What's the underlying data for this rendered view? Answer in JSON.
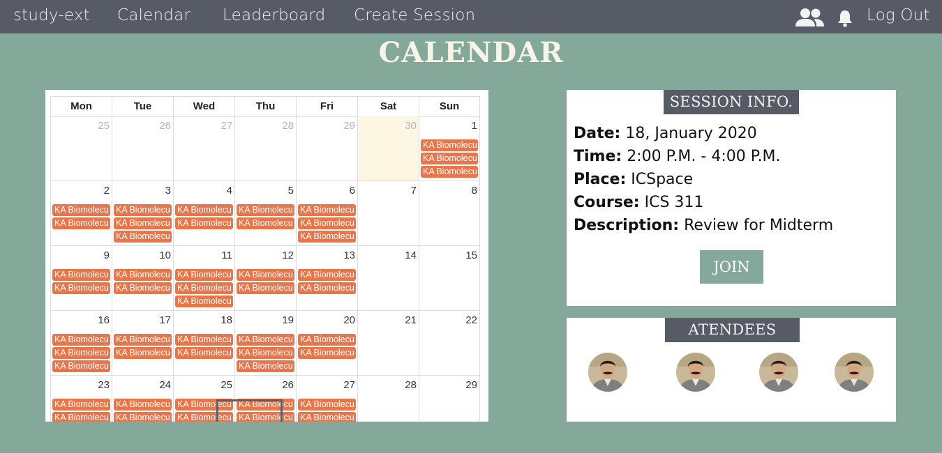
{
  "nav": {
    "brand": "study-ext",
    "calendar": "Calendar",
    "leaderboard": "Leaderboard",
    "create_session": "Create Session",
    "logout": "Log Out"
  },
  "page_title": "CALENDAR",
  "calendar": {
    "weekdays": [
      "Mon",
      "Tue",
      "Wed",
      "Thu",
      "Fri",
      "Sat",
      "Sun"
    ],
    "event_label": "KA Biomolecu",
    "selected_day": "18",
    "today": "30",
    "weeks": [
      [
        {
          "day": "25",
          "other": true,
          "events": 0
        },
        {
          "day": "26",
          "other": true,
          "events": 0
        },
        {
          "day": "27",
          "other": true,
          "events": 0
        },
        {
          "day": "28",
          "other": true,
          "events": 0
        },
        {
          "day": "29",
          "other": true,
          "events": 0
        },
        {
          "day": "30",
          "other": true,
          "events": 0,
          "today": true
        },
        {
          "day": "1",
          "events": 3
        }
      ],
      [
        {
          "day": "2",
          "events": 2
        },
        {
          "day": "3",
          "events": 3
        },
        {
          "day": "4",
          "events": 2
        },
        {
          "day": "5",
          "events": 2
        },
        {
          "day": "6",
          "events": 3
        },
        {
          "day": "7",
          "events": 0
        },
        {
          "day": "8",
          "events": 0
        }
      ],
      [
        {
          "day": "9",
          "events": 2
        },
        {
          "day": "10",
          "events": 2
        },
        {
          "day": "11",
          "events": 3
        },
        {
          "day": "12",
          "events": 2
        },
        {
          "day": "13",
          "events": 2
        },
        {
          "day": "14",
          "events": 0
        },
        {
          "day": "15",
          "events": 0
        }
      ],
      [
        {
          "day": "16",
          "events": 3
        },
        {
          "day": "17",
          "events": 2
        },
        {
          "day": "18",
          "events": 2
        },
        {
          "day": "19",
          "events": 3
        },
        {
          "day": "20",
          "events": 2
        },
        {
          "day": "21",
          "events": 0
        },
        {
          "day": "22",
          "events": 0
        }
      ],
      [
        {
          "day": "23",
          "events": 2
        },
        {
          "day": "24",
          "events": 2
        },
        {
          "day": "25",
          "events": 2
        },
        {
          "day": "26",
          "events": 2
        },
        {
          "day": "27",
          "events": 2
        },
        {
          "day": "28",
          "events": 0
        },
        {
          "day": "29",
          "events": 0
        }
      ]
    ]
  },
  "session_info": {
    "heading": "SESSION INFO.",
    "date_label": "Date:",
    "date_value": "18, January 2020",
    "time_label": "Time:",
    "time_value": "2:00 P.M. - 4:00 P.M.",
    "place_label": "Place:",
    "place_value": "ICSpace",
    "course_label": "Course:",
    "course_value": "ICS 311",
    "description_label": "Description:",
    "description_value": "Review for Midterm",
    "join_label": "JOIN"
  },
  "attendees": {
    "heading": "ATENDEES",
    "count": 4
  },
  "colors": {
    "page_bg": "#84a89a",
    "nav_bg": "#575b66",
    "event": "#e8764a",
    "today_bg": "#fcf6e2"
  }
}
